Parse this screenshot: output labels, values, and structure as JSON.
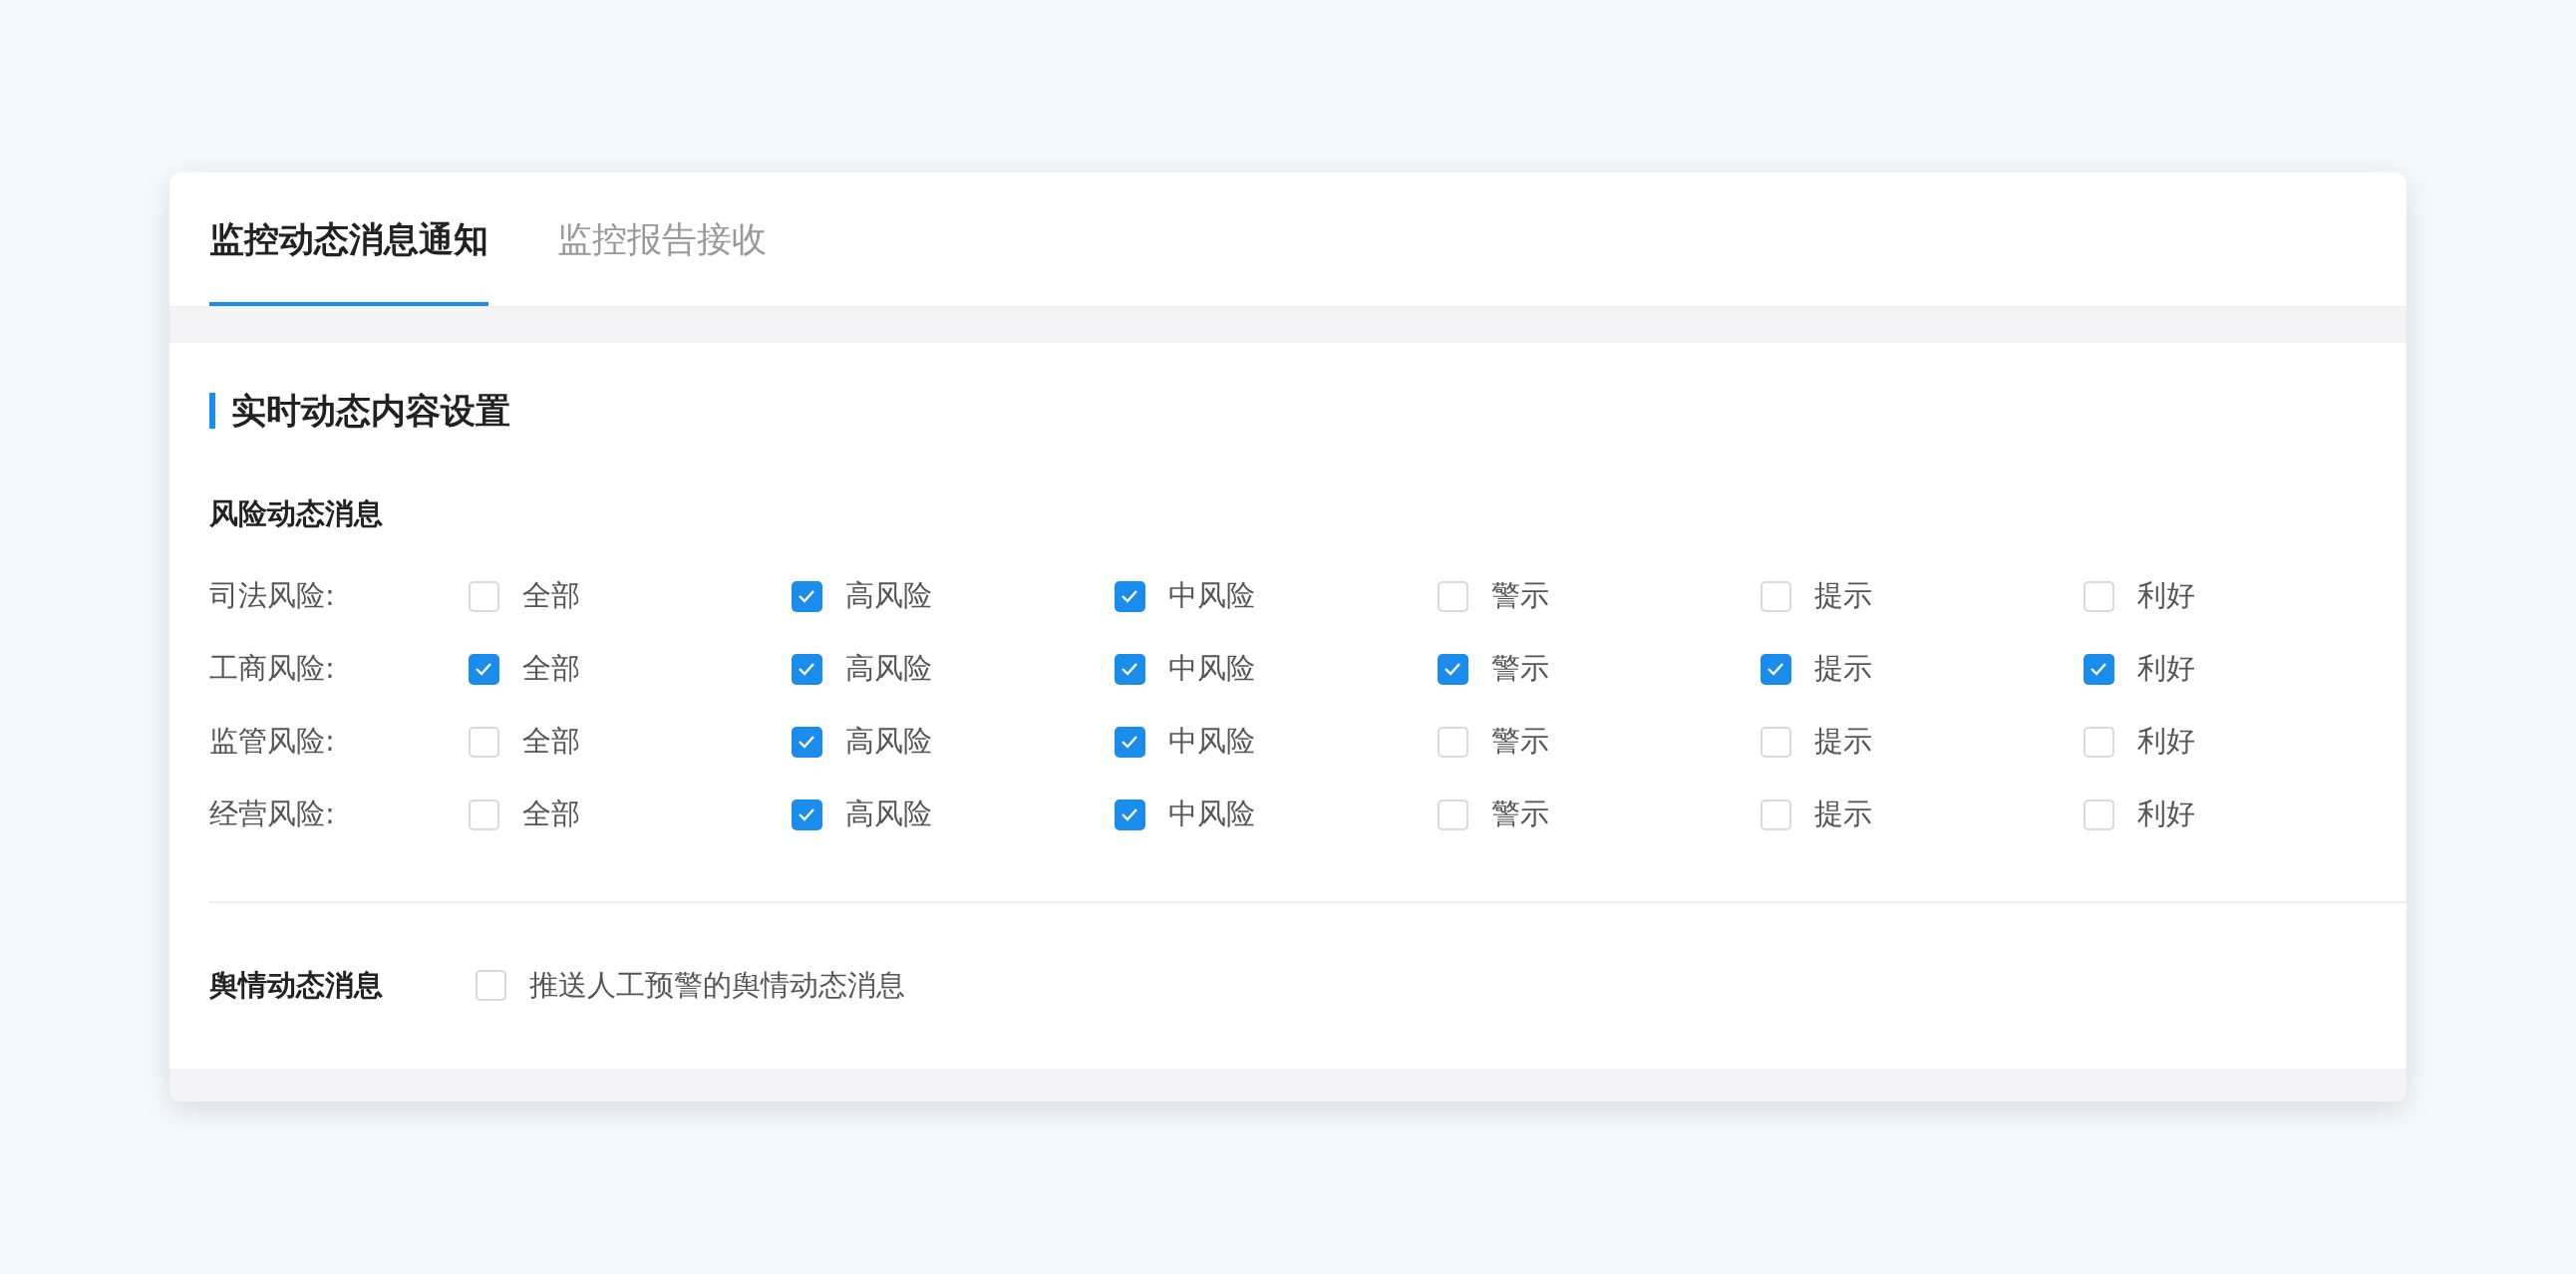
{
  "tabs": [
    {
      "label": "监控动态消息通知",
      "selected": true
    },
    {
      "label": "监控报告接收",
      "selected": false
    }
  ],
  "section_title": "实时动态内容设置",
  "risk_group": {
    "title": "风险动态消息",
    "rows": [
      {
        "label": "司法风险:",
        "options": [
          {
            "label": "全部",
            "checked": false
          },
          {
            "label": "高风险",
            "checked": true
          },
          {
            "label": "中风险",
            "checked": true
          },
          {
            "label": "警示",
            "checked": false
          },
          {
            "label": "提示",
            "checked": false
          },
          {
            "label": "利好",
            "checked": false
          }
        ]
      },
      {
        "label": "工商风险:",
        "options": [
          {
            "label": "全部",
            "checked": true
          },
          {
            "label": "高风险",
            "checked": true
          },
          {
            "label": "中风险",
            "checked": true
          },
          {
            "label": "警示",
            "checked": true
          },
          {
            "label": "提示",
            "checked": true
          },
          {
            "label": "利好",
            "checked": true
          }
        ]
      },
      {
        "label": "监管风险:",
        "options": [
          {
            "label": "全部",
            "checked": false
          },
          {
            "label": "高风险",
            "checked": true
          },
          {
            "label": "中风险",
            "checked": true
          },
          {
            "label": "警示",
            "checked": false
          },
          {
            "label": "提示",
            "checked": false
          },
          {
            "label": "利好",
            "checked": false
          }
        ]
      },
      {
        "label": "经营风险:",
        "options": [
          {
            "label": "全部",
            "checked": false
          },
          {
            "label": "高风险",
            "checked": true
          },
          {
            "label": "中风险",
            "checked": true
          },
          {
            "label": "警示",
            "checked": false
          },
          {
            "label": "提示",
            "checked": false
          },
          {
            "label": "利好",
            "checked": false
          }
        ]
      }
    ]
  },
  "sentiment": {
    "title": "舆情动态消息",
    "option": {
      "label": "推送人工预警的舆情动态消息",
      "checked": false
    }
  }
}
